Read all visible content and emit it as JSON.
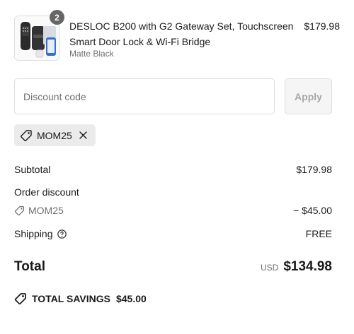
{
  "product": {
    "title": "DESLOC B200 with G2 Gateway Set, Touchscreen Smart Door Lock & Wi-Fi Bridge",
    "variant": "Matte Black",
    "price": "$179.98",
    "quantity": "2",
    "image_icon": "smart-lock-product-image"
  },
  "discount": {
    "placeholder": "Discount code",
    "value": "",
    "apply_label": "Apply",
    "applied_code": "MOM25"
  },
  "summary": {
    "subtotal_label": "Subtotal",
    "subtotal_value": "$179.98",
    "order_discount_label": "Order discount",
    "discount_code": "MOM25",
    "discount_value": "− $45.00",
    "shipping_label": "Shipping",
    "shipping_value": "FREE",
    "total_label": "Total",
    "currency": "USD",
    "total_value": "$134.98",
    "savings_label": "TOTAL SAVINGS",
    "savings_value": "$45.00"
  },
  "colors": {
    "text": "#1a1a1a",
    "muted": "#707070",
    "border": "#dedede",
    "chip_background": "#ebebeb",
    "badge": "#666666"
  }
}
